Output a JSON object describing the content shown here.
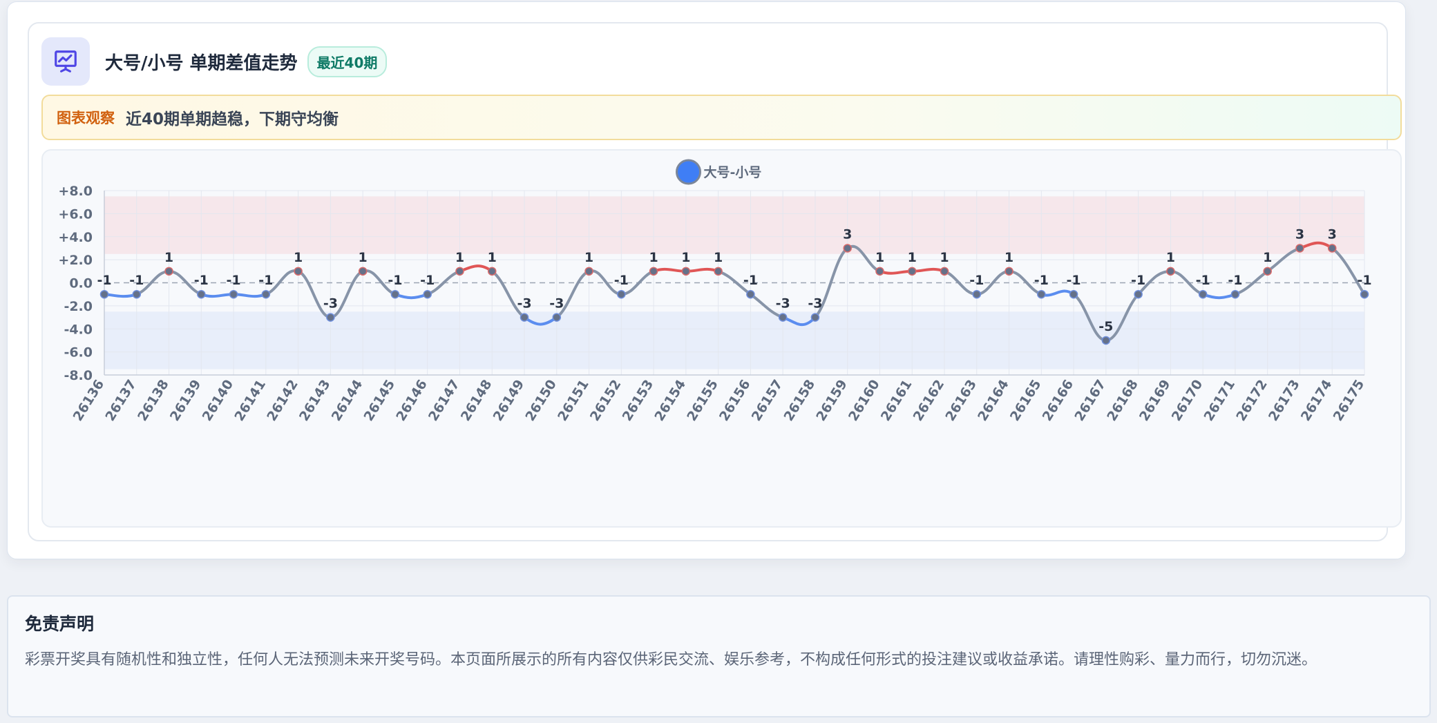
{
  "panel": {
    "title": "大号/小号 单期差值走势",
    "badge": "最近40期",
    "icon": "presentation-chart-icon",
    "insight_label": "图表观察",
    "insight_text": "近40期单期趋稳，下期守均衡"
  },
  "chart_data": {
    "type": "line",
    "legend_position": "top-center",
    "grid": true,
    "x": [
      "26136",
      "26137",
      "26138",
      "26139",
      "26140",
      "26141",
      "26142",
      "26143",
      "26144",
      "26145",
      "26146",
      "26147",
      "26148",
      "26149",
      "26150",
      "26151",
      "26152",
      "26153",
      "26154",
      "26155",
      "26156",
      "26157",
      "26158",
      "26159",
      "26160",
      "26161",
      "26162",
      "26163",
      "26164",
      "26165",
      "26166",
      "26167",
      "26168",
      "26169",
      "26170",
      "26171",
      "26172",
      "26173",
      "26174",
      "26175"
    ],
    "series": [
      {
        "name": "大号-小号",
        "values": [
          -1,
          -1,
          1,
          -1,
          -1,
          -1,
          1,
          -3,
          1,
          -1,
          -1,
          1,
          1,
          -3,
          -3,
          1,
          -1,
          1,
          1,
          1,
          -1,
          -3,
          -3,
          3,
          1,
          1,
          1,
          -1,
          1,
          -1,
          -1,
          -5,
          -1,
          1,
          -1,
          -1,
          1,
          3,
          3,
          -1
        ]
      }
    ],
    "ylim": [
      -8,
      8
    ],
    "yticks": [
      "+8.0",
      "+6.0",
      "+4.0",
      "+2.0",
      "0.0",
      "-2.0",
      "-4.0",
      "-6.0",
      "-8.0"
    ],
    "bands": [
      {
        "from": 2.5,
        "to": 7.5,
        "color": "#f6e7eb"
      },
      {
        "from": -7.5,
        "to": -2.5,
        "color": "#e8eefa"
      }
    ],
    "colors": {
      "positive": "#e05656",
      "negative": "#5b8def",
      "neutral": "#8794a8",
      "legend_dot": "#3f7ef5",
      "point": "#657189"
    }
  },
  "disclaimer": {
    "title": "免责声明",
    "text": "彩票开奖具有随机性和独立性，任何人无法预测未来开奖号码。本页面所展示的所有内容仅供彩民交流、娱乐参考，不构成任何形式的投注建议或收益承诺。请理性购彩、量力而行，切勿沉迷。"
  }
}
